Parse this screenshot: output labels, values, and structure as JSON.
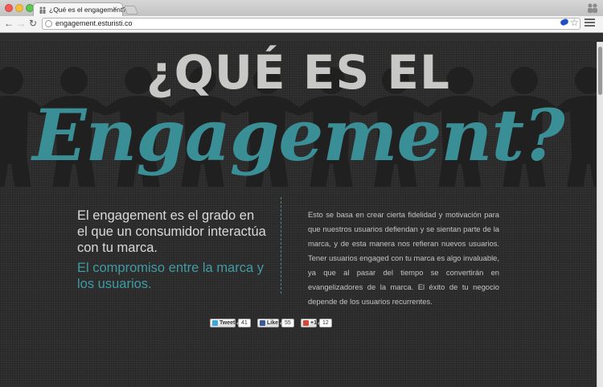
{
  "browser": {
    "tab_title": "¿Qué es el engagement?",
    "url": "engagement.esturisti.co"
  },
  "hero": {
    "headline_top": "¿QUÉ ES EL",
    "headline_script": "Engagement?"
  },
  "intro": {
    "lead": "El engagement es el grado en el que un consumidor interactúa con tu marca.",
    "accent": "El compromiso entre la marca y los usuarios.",
    "body": "Esto se basa en crear cierta fidelidad y motivación para que nuestros usuarios defiendan y se sientan parte de la marca, y de esta manera nos refieran nuevos usuarios. Tener usuarios engaged con tu marca es algo invaluable, ya que al pasar del tiempo se convertirán en evangelizadores de la marca. El éxito de tu negocio depende de los usuarios recurrentes."
  },
  "social": {
    "tweet_label": "Tweet",
    "tweet_count": "41",
    "like_label": "Like",
    "like_count": "55",
    "plus_label": "+1",
    "plus_count": "12"
  },
  "colors": {
    "accent": "#3a8f97",
    "headline": "#c8c8c6",
    "background": "#2d2d2d"
  }
}
